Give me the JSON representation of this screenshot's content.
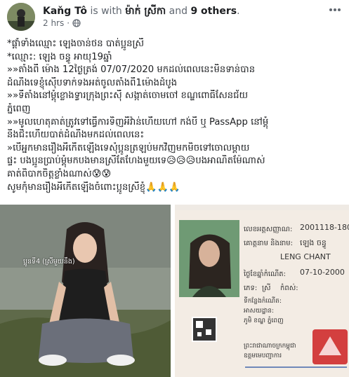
{
  "post": {
    "author_name": "Kaňg Tô",
    "is_with_text": " is with ",
    "tagged_name": "ម៉ាក់ ស្រីកា",
    "and_text": " and ",
    "others_text": "9 others",
    "end_text": ".",
    "timestamp": "2 hrs",
    "separator": "·",
    "privacy_icon": "globe-icon",
    "more_icon": "more-options-icon"
  },
  "text_lines": [
    "*ផ្តាំទាំងឈ្មោះ ឡេងចាន់ថន បាត់ប្អូនស្រី",
    "*ឈ្មោះ: ឡេង ចន្ធូ អាយុ19ឆ្នាំ",
    "»»តាំងពី ម៉ោង 12ថ្ងៃត្រង់ 07/07/2020 មកដល់ពេលនេះមិនទាន់បាន",
    "ដំណឹងទេខ្ញុំស៊ើបទាក់ទងអត់ចូលតាំងពី1ម៉ោងដំបូង",
    "»»ទីតាំងនៅម្តុំខ្លោងទ្វារក្រុងព្រះស៊ី សង្កាត់ចោមចៅ ខណ្ឌពោធិ៍សែនជ័យ",
    "ភ្នំពេញ",
    "»»មូលហេតុគាត់ត្រូវទៅធ្វើការទិញអីវ៉ាន់ហើយហៅ កង់បី ឬ PassApp នៅម្តុំ",
    "នឹងជិះហើយបាត់ដំណឹងមកដល់ពេលនេះ",
    "»បើអ្នកមានរឿងអីកើតឡើងទេសុំប្អូនត្រឡប់មកវិញមកមិចទៅចោលម្តាយ",
    "ផ្ទះ បងប្អូនប្រាប់ម្តុំមកបងមានស្រីតែហែងមួយទេ😥😥😥បងអាណិតម៉ែណាស់",
    "គាត់ពិបាកចិត្តខ្លាំងណាស់😰😰",
    "សូមកុំមានរឿងអីកើតឡើងចំពោះប្អូនស្រីខ្ញុំ🙏🙏🙏"
  ],
  "photo1": {
    "caption": "ប្អូនទី4 (ស្រីមួយនឹង)"
  },
  "photo2": {
    "id_no_label": "លេខអត្តសញ្ញាណ:",
    "id_no_value": "2001118-180",
    "name_label": "គោត្តនាម និងនាម:",
    "name_value": "ឡេង ចន្ធូ",
    "latin_name": "LENG CHANT",
    "dob_label": "ថ្ងៃខែឆ្នាំកំណើត:",
    "dob_value": "07-10-2000",
    "sex_label": "ភេទ:",
    "sex_value": "ស្រី",
    "height_label": "កំពស់:",
    "address_line1": "ទីកន្លែងកំណើត:",
    "address_line2": "អាសយដ្ឋាន:",
    "address_line3": "ភូមិ ខណ្ឌ ភ្នំពេញ",
    "footer_line1": "ព្រះរាជាណាចក្រកម្ពុជា",
    "footer_line2": "ឧត្តមមេបញ្ជាការ"
  }
}
